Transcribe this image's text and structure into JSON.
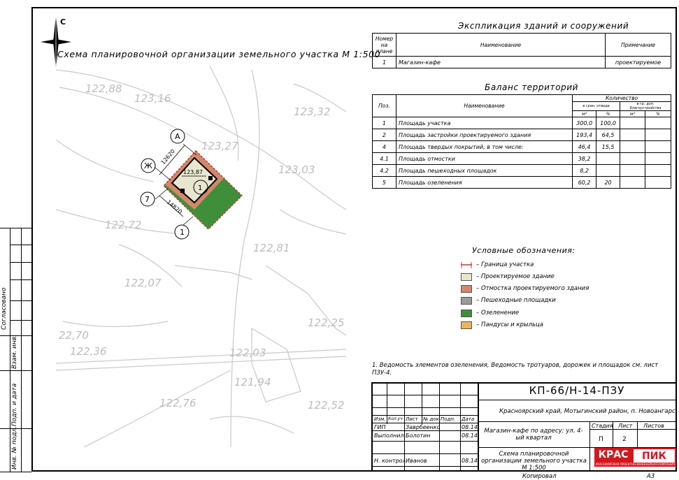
{
  "sheet": {
    "title": "Схема планировочной организации земельного участка М 1:500",
    "north_label": "С",
    "copied_label": "Копировал",
    "format_label": "А3"
  },
  "map": {
    "elevations": [
      "122,88",
      "123,16",
      "123,32",
      "123,27",
      "123,03",
      "122,72",
      "122,81",
      "122,07",
      "122,25",
      "22,70",
      "122,36",
      "122,03",
      "121,94",
      "122,76",
      "122,52"
    ],
    "building_elevation": "123,87",
    "building_number": "1",
    "dim_top": "12620",
    "dim_bottom": "14820",
    "axis_labels": {
      "a": "А",
      "zh": "Ж",
      "seven": "7",
      "one": "1"
    }
  },
  "explication": {
    "title": "Экспликация зданий и сооружений",
    "headers": [
      "Номер на плане",
      "Наименование",
      "Примечание"
    ],
    "rows": [
      {
        "num": "1",
        "name": "Магазин-кафе",
        "note": "проектируемое"
      }
    ]
  },
  "balance": {
    "title": "Баланс территорий",
    "headers": {
      "pos": "Поз.",
      "name": "Наименование",
      "qty": "Количество",
      "in_border": "в гран. отвода",
      "in_improve": "в гр. доп. благоустройства",
      "m2": "м²",
      "pct": "%"
    },
    "rows": [
      {
        "pos": "1",
        "name": "Площадь участка",
        "m2": "300,0",
        "pct": "100,0"
      },
      {
        "pos": "2",
        "name": "Площадь застройки проектируемого здания",
        "m2": "193,4",
        "pct": "64,5"
      },
      {
        "pos": "4",
        "name": "Площадь твердых покрытий, в том числе:",
        "m2": "46,4",
        "pct": "15,5"
      },
      {
        "pos": "4.1",
        "name": "Площадь отмостки",
        "m2": "38,2",
        "pct": ""
      },
      {
        "pos": "4.2",
        "name": "Площадь пешеходных площадок",
        "m2": "8,2",
        "pct": ""
      },
      {
        "pos": "5",
        "name": "Площадь озеленения",
        "m2": "60,2",
        "pct": "20"
      }
    ]
  },
  "legend": {
    "title": "Условные обозначения:",
    "items": [
      {
        "label": "– Граница участка",
        "color": "#ffffff"
      },
      {
        "label": "– Проектируемое здание",
        "color": "#e9e6cf"
      },
      {
        "label": "– Отмостка проектируемого здания",
        "color": "#d4876a"
      },
      {
        "label": "– Пешеходные площадки",
        "color": "#9a9a9a"
      },
      {
        "label": "– Озеленение",
        "color": "#3f8f3a"
      },
      {
        "label": "– Пандусы и крыльца",
        "color": "#f0b45a"
      }
    ]
  },
  "note": "1. Ведомость элементов озеленения, Ведомость тротуаров, дорожек и площадок см. лист ПЗУ-4.",
  "stamp": {
    "code": "КП-66/Н-14-ПЗУ",
    "location": "Красноярский край,  Мотыгинский район, п. Новоангарск",
    "object": "Магазин-кафе по адресу: ул. 4-ый квартал",
    "sheet_name": "Схема планировочной организации земельного участка М 1:500",
    "col_headers": [
      "Изм.",
      "Кол.уч",
      "Лист",
      "№ док",
      "Подп.",
      "Дата"
    ],
    "people": [
      {
        "role": "ГИП",
        "name": "Заврбеенко",
        "date": "08.14"
      },
      {
        "role": "Выполнил",
        "name": "Болотин",
        "date": "08.14"
      },
      {
        "role": "Н. контроль",
        "name": "Иванов",
        "date": "08.14"
      }
    ],
    "stage_label": "Стадия",
    "sheet_label": "Лист",
    "sheets_label": "Листов",
    "stage": "П",
    "sheet": "2",
    "sheets": "",
    "logo_left": "КРАС",
    "logo_right": "ПИК",
    "logo_sub": "КРАСНОЯРСКАЯ ПРОЕКТНО-ИНЖЕНЕРНАЯ КОМПАНИЯ"
  },
  "side_stamp": {
    "agreed": "Согласовано",
    "inv_orig": "Инв. № подл.",
    "sign_date": "Подп. и дата",
    "inv_sub": "Взам. инв."
  }
}
